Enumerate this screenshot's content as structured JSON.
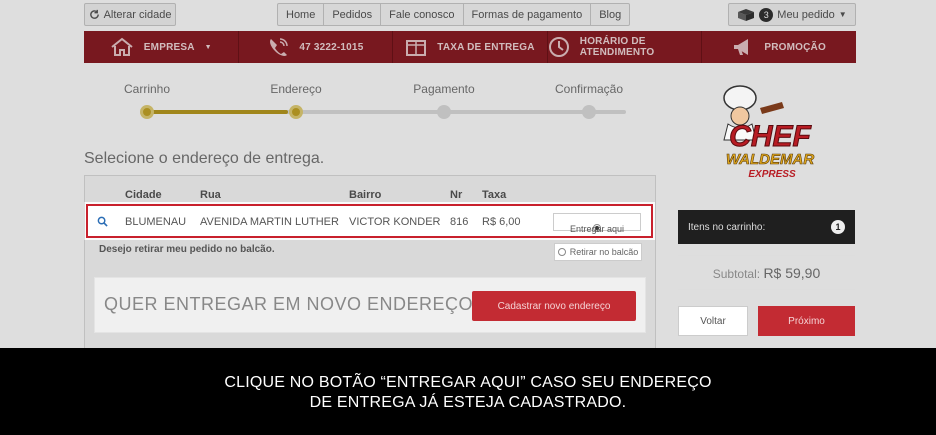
{
  "topbar": {
    "change_city": "Alterar cidade",
    "nav": [
      "Home",
      "Pedidos",
      "Fale conosco",
      "Formas de pagamento",
      "Blog"
    ],
    "order_count": "3",
    "my_order": "Meu pedido"
  },
  "rednav": {
    "items": [
      {
        "label": "EMPRESA",
        "icon": "house-icon",
        "caret": true
      },
      {
        "label": "47 3222-1015",
        "icon": "phone-icon"
      },
      {
        "label": "TAXA DE ENTREGA",
        "icon": "box-icon"
      },
      {
        "label": "HORÁRIO DE ATENDIMENTO",
        "icon": "clock-icon"
      },
      {
        "label": "PROMOÇÃO",
        "icon": "megaphone-icon"
      }
    ]
  },
  "steps": [
    "Carrinho",
    "Endereço",
    "Pagamento",
    "Confirmação"
  ],
  "section_title": "Selecione o endereço de entrega.",
  "table": {
    "headers": [
      "Cidade",
      "Rua",
      "Bairro",
      "Nr",
      "Taxa"
    ],
    "rows": [
      {
        "cidade": "BLUMENAU",
        "rua": "AVENIDA MARTIN LUTHER",
        "bairro": "VICTOR KONDER",
        "nr": "816",
        "taxa": "R$ 6,00",
        "action": "Entregar aqui"
      }
    ]
  },
  "pickup": {
    "label": "Desejo retirar meu pedido no balcão.",
    "button": "Retirar no balcão"
  },
  "new_address": {
    "text": "QUER ENTREGAR EM NOVO ENDEREÇO?",
    "button": "Cadastrar novo endereço"
  },
  "logo": {
    "line1": "CHEF",
    "line2": "WALDEMAR",
    "line3": "EXPRESS"
  },
  "cart": {
    "label": "Itens no carrinho:",
    "count": "1"
  },
  "subtotal": {
    "label": "Subtotal:",
    "value": "R$ 59,90"
  },
  "buttons": {
    "back": "Voltar",
    "next": "Próximo"
  },
  "caption": {
    "line1": "CLIQUE NO BOTÃO “ENTREGAR AQUI” CASO SEU ENDEREÇO",
    "line2": "DE ENTREGA JÁ ESTEJA CADASTRADO."
  },
  "colors": {
    "brand_red": "#8a1c24",
    "button_red": "#c32b33",
    "step_gold": "#c5a526",
    "highlight": "#c8202c"
  }
}
